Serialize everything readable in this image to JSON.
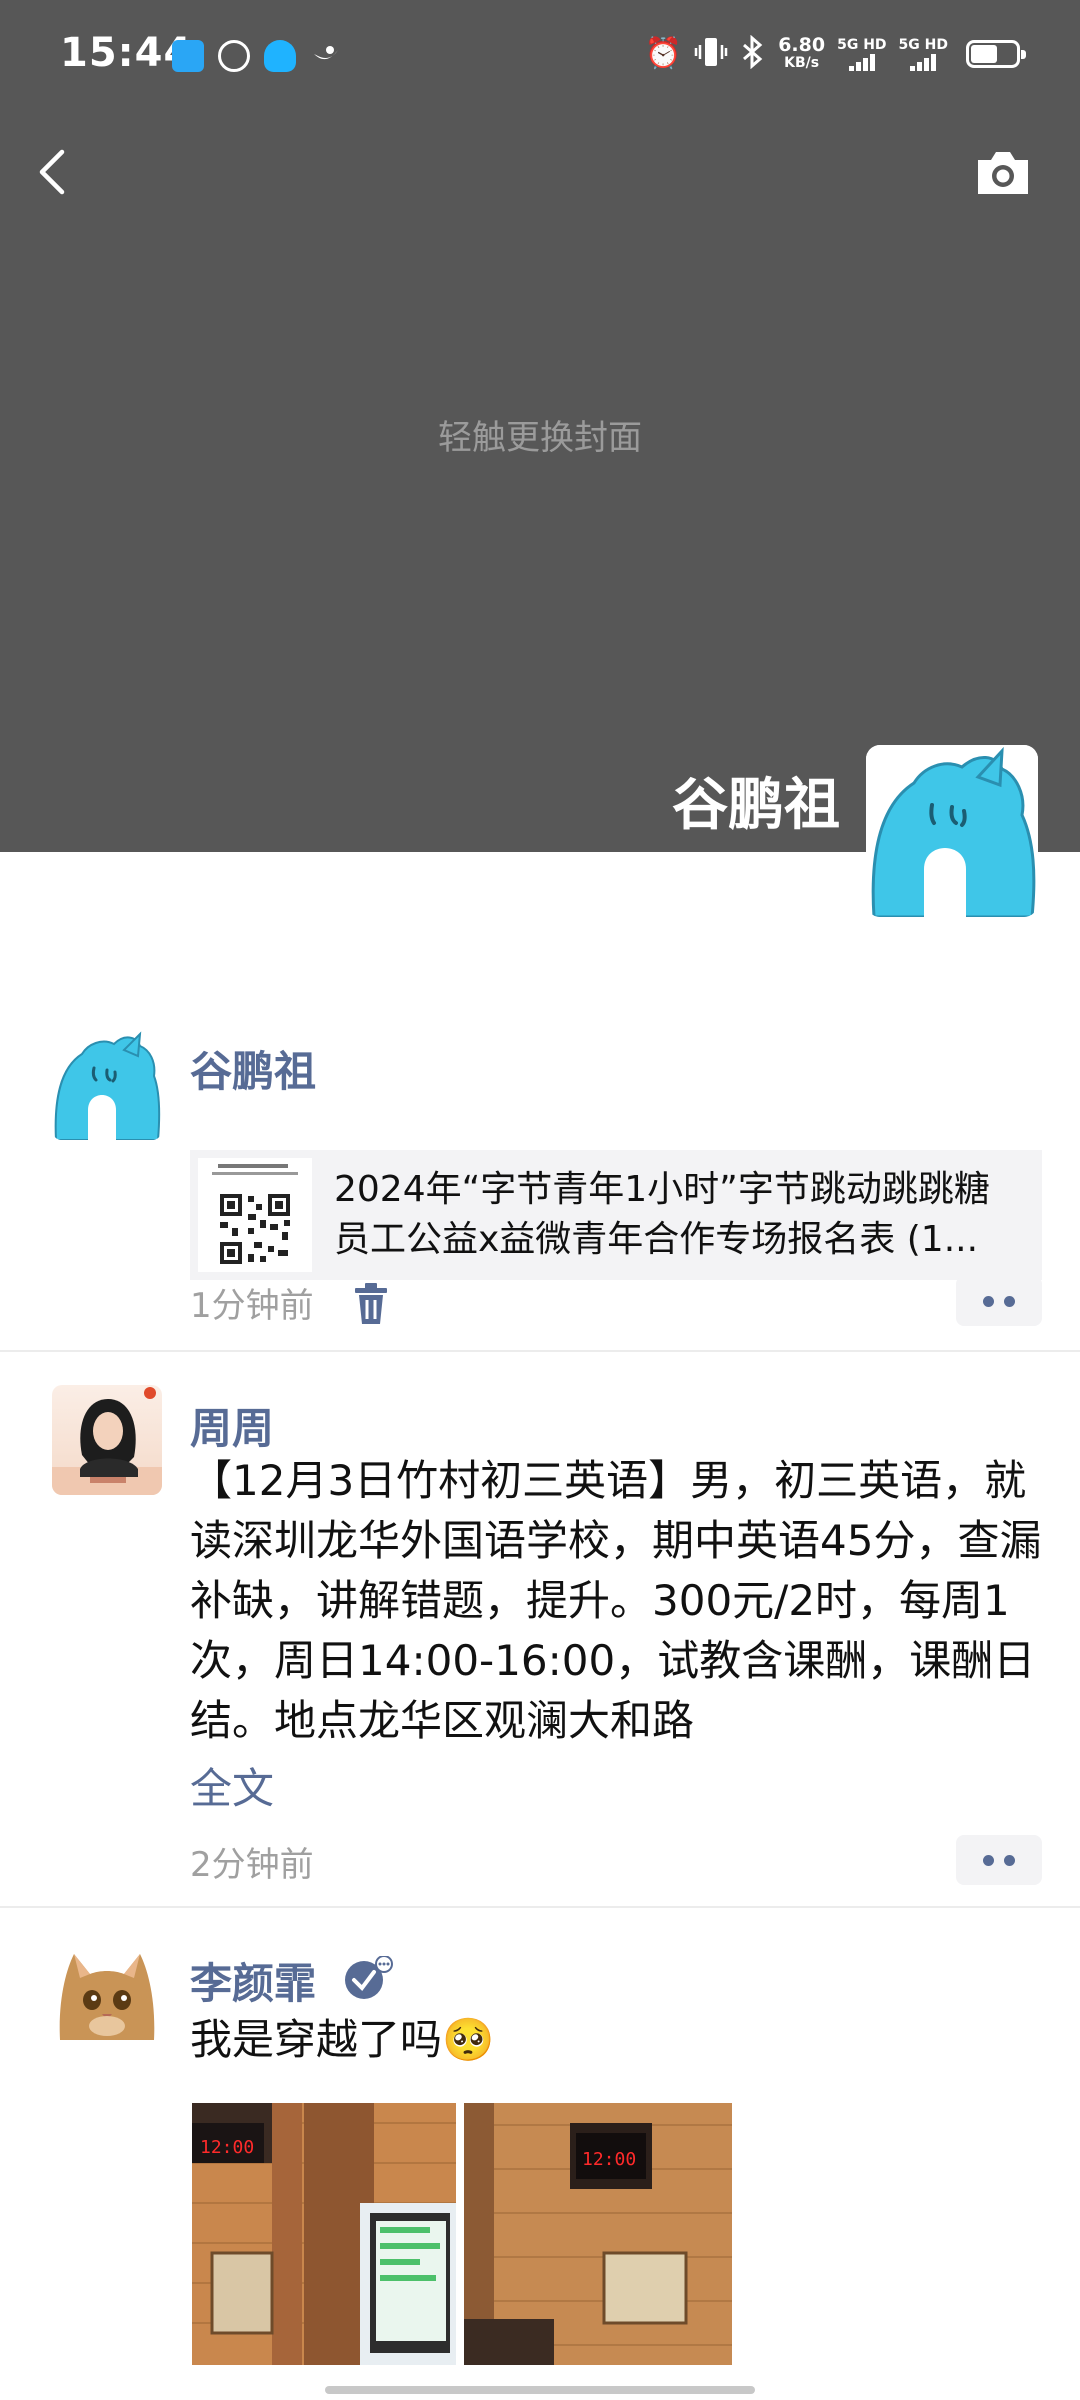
{
  "status_bar": {
    "time": "15:44",
    "net_speed_value": "6.80",
    "net_speed_unit": "KB/s",
    "sim1_label": "5G HD",
    "sim2_label": "5G HD",
    "battery_level": 0.6
  },
  "cover": {
    "hint": "轻触更换封面",
    "profile_name": "谷鹏祖"
  },
  "posts": [
    {
      "author": "谷鹏祖",
      "share_title_line1": "2024年“字节青年1小时”字节跳动跳跳糖",
      "share_title_line2": "员工公益x益微青年合作专场报名表 (1...",
      "time": "1分钟前"
    },
    {
      "author": "周周",
      "text": "【12月3日竹村初三英语】男，初三英语，就读深圳龙华外国语学校，期中英语45分，查漏补缺，讲解错题，提升。300元/2时，每周1次，周日14:00-16:00，试教含课酬，课酬日结。地点龙华区观澜大和路",
      "full_text_label": "全文",
      "time": "2分钟前"
    },
    {
      "author": "李颜霏",
      "text": "我是穿越了吗🥺",
      "clock_text": "12:00"
    }
  ],
  "colors": {
    "cover_bg": "#575757",
    "name_link": "#576b95",
    "meta_text": "#a0a0a0",
    "avatar_blue": "#3fc6e8"
  },
  "icons": [
    "back-arrow-icon",
    "camera-icon",
    "trash-icon",
    "more-dots-icon",
    "verified-badge-icon",
    "alarm-icon",
    "vibrate-icon",
    "bluetooth-icon"
  ]
}
